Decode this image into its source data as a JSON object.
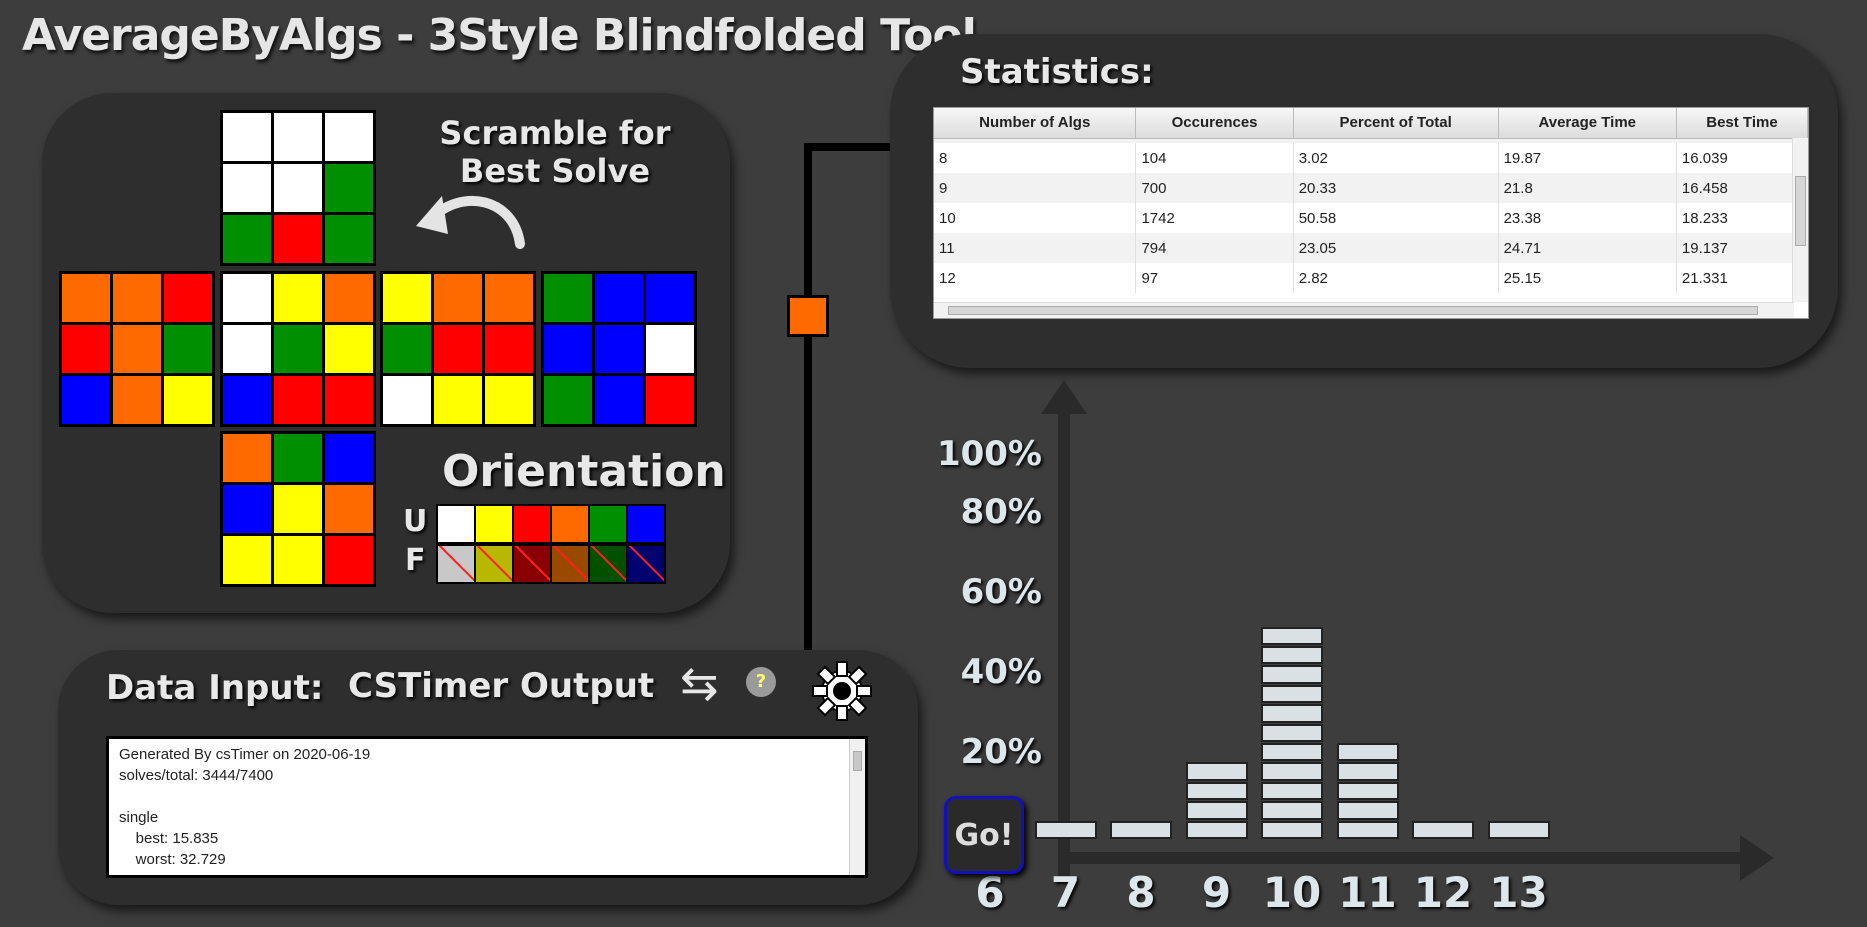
{
  "app_title": "AverageByAlgs - 3Style Blindfolded Tool",
  "scramble_panel": {
    "label": "Scramble for Best Solve",
    "faces": {
      "U": [
        "W",
        "W",
        "W",
        "W",
        "W",
        "G",
        "G",
        "R",
        "G"
      ],
      "L": [
        "O",
        "O",
        "R",
        "R",
        "O",
        "G",
        "B",
        "O",
        "Y"
      ],
      "F": [
        "W",
        "Y",
        "O",
        "W",
        "G",
        "Y",
        "B",
        "R",
        "R"
      ],
      "R": [
        "Y",
        "O",
        "O",
        "G",
        "R",
        "R",
        "W",
        "Y",
        "Y"
      ],
      "B": [
        "G",
        "B",
        "B",
        "B",
        "B",
        "W",
        "G",
        "B",
        "R"
      ],
      "D": [
        "O",
        "G",
        "B",
        "B",
        "Y",
        "O",
        "Y",
        "Y",
        "R"
      ]
    },
    "orientation_label": "Orientation",
    "orientation_rows": [
      {
        "label": "U",
        "colors": [
          "#ffffff",
          "#ffff00",
          "#ff0000",
          "#ff6a00",
          "#008f00",
          "#0000ff"
        ]
      },
      {
        "label": "F",
        "colors": [
          "#c8c8c8",
          "#b8b800",
          "#8a0000",
          "#9a4a00",
          "#005000",
          "#00006e"
        ]
      }
    ]
  },
  "data_input": {
    "label": "Data Input:",
    "source_label": "CSTimer Output",
    "help_label": "?",
    "text": "Generated By csTimer on 2020-06-19\nsolves/total: 3444/7400\n\nsingle\n    best: 15.835\n    worst: 32.729"
  },
  "statistics": {
    "label": "Statistics:",
    "columns": [
      "Number of Algs",
      "Occurences",
      "Percent of Total",
      "Average Time",
      "Best Time"
    ],
    "rows": [
      [
        "8",
        "104",
        "3.02",
        "19.87",
        "16.039"
      ],
      [
        "9",
        "700",
        "20.33",
        "21.8",
        "16.458"
      ],
      [
        "10",
        "1742",
        "50.58",
        "23.38",
        "18.233"
      ],
      [
        "11",
        "794",
        "23.05",
        "24.71",
        "19.137"
      ],
      [
        "12",
        "97",
        "2.82",
        "25.15",
        "21.331"
      ]
    ]
  },
  "go_button": "Go!",
  "chart_data": {
    "type": "bar",
    "categories": [
      "6",
      "7",
      "8",
      "9",
      "10",
      "11",
      "12",
      "13"
    ],
    "values": [
      0,
      0.3,
      0.3,
      20.33,
      50.58,
      23.05,
      0.3,
      0.3
    ],
    "y_tick_labels": [
      "20%",
      "40%",
      "60%",
      "80%",
      "100%"
    ],
    "ylim": [
      0,
      100
    ],
    "bar_color": "#d9e1e5"
  }
}
